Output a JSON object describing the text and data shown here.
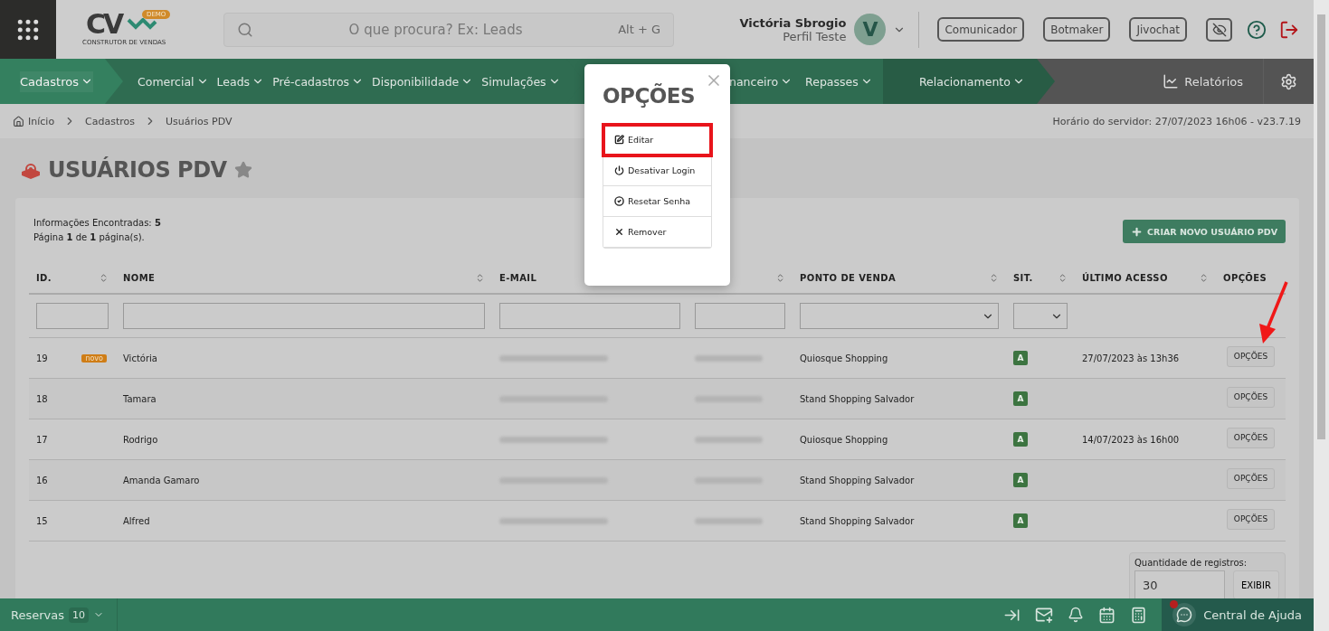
{
  "topbar": {
    "logo": {
      "mark": "CV",
      "tag": "DEMO",
      "subtitle": "CONSTRUTOR DE VENDAS"
    },
    "search": {
      "placeholder": "O que procura? Ex: Leads",
      "shortcut": "Alt + G"
    },
    "user": {
      "name": "Victória Sbrogio",
      "profile": "Perfil Teste",
      "initial": "V"
    },
    "buttons": [
      "Comunicador",
      "Botmaker",
      "Jivochat"
    ]
  },
  "nav": {
    "groups": [
      {
        "kind": "lead",
        "items": [
          {
            "label": "Cadastros",
            "selected": true
          }
        ]
      },
      {
        "kind": "main",
        "items": [
          {
            "label": "Comercial",
            "selected": false
          },
          {
            "label": "Leads",
            "selected": false
          },
          {
            "label": "Pré-cadastros",
            "selected": false
          },
          {
            "label": "Disponibilidade",
            "selected": false
          },
          {
            "label": "Simulações",
            "selected": false
          }
        ]
      },
      {
        "kind": "trail",
        "items": [
          {
            "label": "nanceiro",
            "selected": false
          },
          {
            "label": "Repasses",
            "selected": false
          }
        ]
      },
      {
        "kind": "accent",
        "items": [
          {
            "label": "Relacionamento",
            "selected": false
          }
        ]
      }
    ],
    "reports": "Relatórios"
  },
  "breadcrumb": [
    "Início",
    "Cadastros",
    "Usuários PDV"
  ],
  "server_time": "Horário do servidor: 27/07/2023 16h06 - v23.7.19",
  "page": {
    "title": "USUÁRIOS PDV",
    "favorite": false
  },
  "summary": [
    "Informações Encontradas: **5**",
    "Página **1** de **1** página(s)."
  ],
  "create_button": "CRIAR NOVO USUÁRIO PDV",
  "table": {
    "columns": [
      {
        "label": "ID.",
        "sortable": true,
        "filter": {
          "kind": "text"
        }
      },
      {
        "label": "NOME",
        "sortable": true,
        "filter": {
          "kind": "text"
        }
      },
      {
        "label": "E-MAIL",
        "sortable": false,
        "filter": {
          "kind": "text"
        }
      },
      {
        "sortable": true,
        "filter": {
          "kind": "text"
        }
      },
      {
        "label": "PONTO DE VENDA",
        "sortable": true,
        "filter": {
          "kind": "select"
        }
      },
      {
        "label": "SIT.",
        "sortable": true,
        "filter": {
          "kind": "select"
        }
      },
      {
        "label": "ÚLTIMO ACESSO",
        "sortable": true
      },
      {
        "label": "OPÇÕES",
        "sortable": false
      }
    ],
    "rows": [
      {
        "id": "19",
        "badge": "novo",
        "name": "Victória",
        "email_redacted": true,
        "phone_redacted": true,
        "point": "Quiosque Shopping",
        "status": "A",
        "last_access": "27/07/2023 às 13h36",
        "options": "OPÇÕES",
        "pointed": true
      },
      {
        "id": "18",
        "name": "Tamara",
        "email_redacted": true,
        "phone_redacted": true,
        "point": "Stand Shopping Salvador",
        "status": "A",
        "options": "OPÇÕES",
        "pointed": false
      },
      {
        "id": "17",
        "name": "Rodrigo",
        "email_redacted": true,
        "phone_redacted": true,
        "point": "Quiosque Shopping",
        "status": "A",
        "last_access": "14/07/2023 às 16h00",
        "options": "OPÇÕES",
        "pointed": false
      },
      {
        "id": "16",
        "name": "Amanda Gamaro",
        "email_redacted": true,
        "phone_redacted": true,
        "point": "Stand Shopping Salvador",
        "status": "A",
        "options": "OPÇÕES",
        "pointed": false
      },
      {
        "id": "15",
        "name": "Alfred",
        "email_redacted": true,
        "phone_redacted": true,
        "point": "Stand Shopping Salvador",
        "status": "A",
        "options": "OPÇÕES",
        "pointed": false
      }
    ]
  },
  "pager": {
    "label": "Quantidade de registros:",
    "value": "30",
    "button": "EXIBIR"
  },
  "footer": {
    "reservations": {
      "label": "Reservas",
      "count": "10"
    },
    "help": "Central de Ajuda",
    "notification": true
  },
  "dialog": {
    "title": "OPÇÕES",
    "items": [
      {
        "label": "Editar",
        "kind": "edit",
        "highlighted": true
      },
      {
        "label": "Desativar Login",
        "kind": "power",
        "highlighted": false
      },
      {
        "label": "Resetar Senha",
        "kind": "check",
        "highlighted": false
      },
      {
        "label": "Remover",
        "kind": "remove",
        "highlighted": false
      }
    ]
  }
}
